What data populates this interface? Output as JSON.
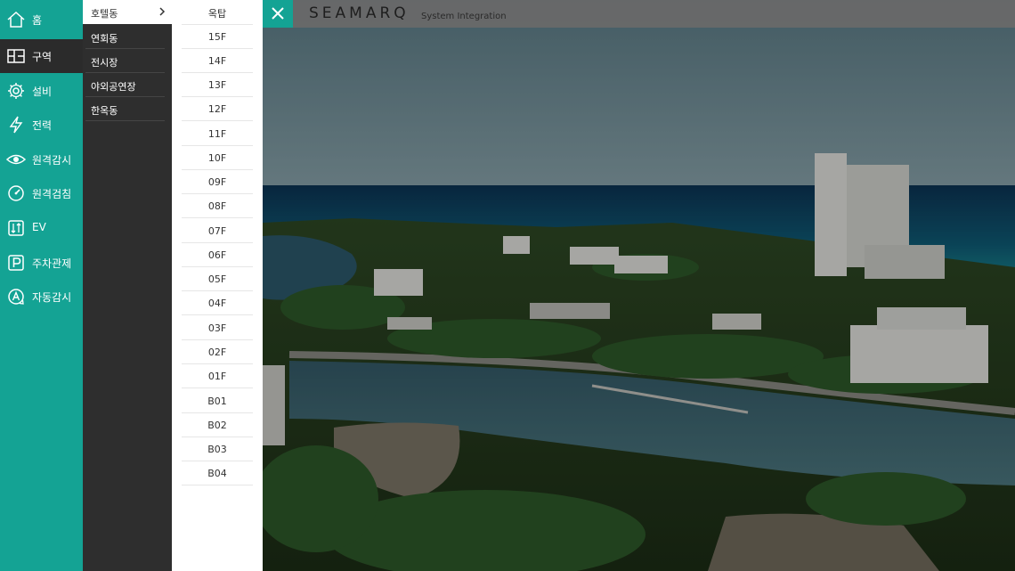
{
  "nav": {
    "items": [
      {
        "label": "홈",
        "icon": "home-icon"
      },
      {
        "label": "구역",
        "icon": "zone-icon",
        "active": true
      },
      {
        "label": "설비",
        "icon": "gear-icon"
      },
      {
        "label": "전력",
        "icon": "lightning-icon"
      },
      {
        "label": "원격감시",
        "icon": "eye-icon"
      },
      {
        "label": "원격검침",
        "icon": "meter-icon"
      },
      {
        "label": "EV",
        "icon": "ev-icon"
      },
      {
        "label": "주차관제",
        "icon": "parking-icon"
      },
      {
        "label": "자동감시",
        "icon": "auto-monitor-icon"
      }
    ]
  },
  "buildings": {
    "items": [
      "호텔동",
      "연회동",
      "전시장",
      "야외공연장",
      "한옥동"
    ],
    "selected": "호텔동"
  },
  "floors": {
    "title": "옥탑",
    "items": [
      "15F",
      "14F",
      "13F",
      "12F",
      "11F",
      "10F",
      "09F",
      "08F",
      "07F",
      "06F",
      "05F",
      "04F",
      "03F",
      "02F",
      "01F",
      "B01",
      "B02",
      "B03",
      "B04"
    ]
  },
  "header": {
    "logo": "SEAMARQ",
    "subtitle": "System Integration"
  },
  "colors": {
    "accent": "#14a394",
    "submenu_bg": "#2e2e2e",
    "topbar_bg": "#6b6b6b"
  }
}
